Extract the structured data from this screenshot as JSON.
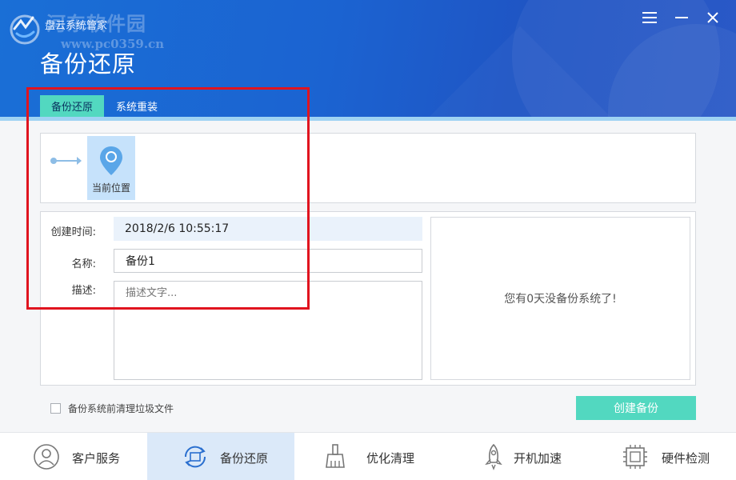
{
  "window": {
    "app_title": "盘云系统管家",
    "watermark_text": "河东软件园",
    "watermark_url": "www.pc0359.cn",
    "page_title": "备份还原"
  },
  "tabs": [
    {
      "label": "备份还原",
      "active": true
    },
    {
      "label": "系统重装",
      "active": false
    }
  ],
  "timeline": {
    "current_label": "当前位置",
    "node_icon": "location-pin-icon"
  },
  "form": {
    "created_label": "创建时间:",
    "created_value": "2018/2/6  10:55:17",
    "name_label": "名称:",
    "name_value": "备份1",
    "desc_label": "描述:",
    "desc_placeholder": "描述文字..."
  },
  "status": {
    "message": "您有0天没备份系统了!"
  },
  "options": {
    "clean_before_backup_label": "备份系统前清理垃圾文件",
    "clean_before_backup_checked": false
  },
  "actions": {
    "create_backup_label": "创建备份"
  },
  "nav": [
    {
      "label": "客户服务",
      "icon": "customer-service-icon",
      "active": false
    },
    {
      "label": "备份还原",
      "icon": "backup-restore-icon",
      "active": true
    },
    {
      "label": "优化清理",
      "icon": "broom-icon",
      "active": false
    },
    {
      "label": "开机加速",
      "icon": "rocket-icon",
      "active": false
    },
    {
      "label": "硬件检测",
      "icon": "chip-icon",
      "active": false
    }
  ],
  "colors": {
    "header_blue": "#1b63d1",
    "accent_teal": "#52d8c0",
    "active_nav_bg": "#dbe9f9",
    "highlight_red": "#e0141f"
  }
}
